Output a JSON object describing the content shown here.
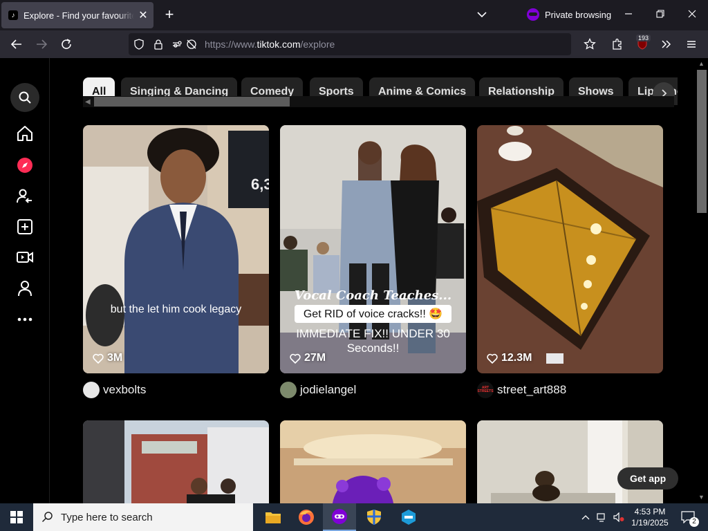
{
  "browser": {
    "tab_title": "Explore - Find your favourite videos on TikTok",
    "tab_close": "✕",
    "new_tab": "+",
    "private_label": "Private browsing",
    "url_scheme": "https://www.",
    "url_host": "tiktok.com",
    "url_path": "/explore",
    "ext_badge": "193"
  },
  "categories": {
    "items": [
      "All",
      "Singing & Dancing",
      "Comedy",
      "Sports",
      "Anime & Comics",
      "Relationship",
      "Shows",
      "Lip-sync"
    ],
    "active_index": 0
  },
  "videos": [
    {
      "caption": "but the let him cook legacy",
      "likes": "3M",
      "author": "vexbolts"
    },
    {
      "overlay_title": "Vocal Coach Teaches...",
      "caption": "Get RID of voice cracks!! 🤩",
      "caption2": "IMMEDIATE FIX!! UNDER 30 Seconds!!",
      "likes": "27M",
      "author": "jodielangel"
    },
    {
      "likes": "12.3M",
      "author": "street_art888",
      "avatar_text": "ART STREETS"
    },
    {
      "author": ""
    },
    {
      "author": ""
    },
    {
      "author": ""
    }
  ],
  "page": {
    "get_app": "Get app"
  },
  "colors": {
    "private_accent": "#8000d7",
    "explore_accent": "#fe2c55",
    "background": "#000000"
  },
  "taskbar": {
    "search_placeholder": "Type here to search",
    "time": "4:53 PM",
    "date": "1/19/2025",
    "notifications": "2"
  }
}
